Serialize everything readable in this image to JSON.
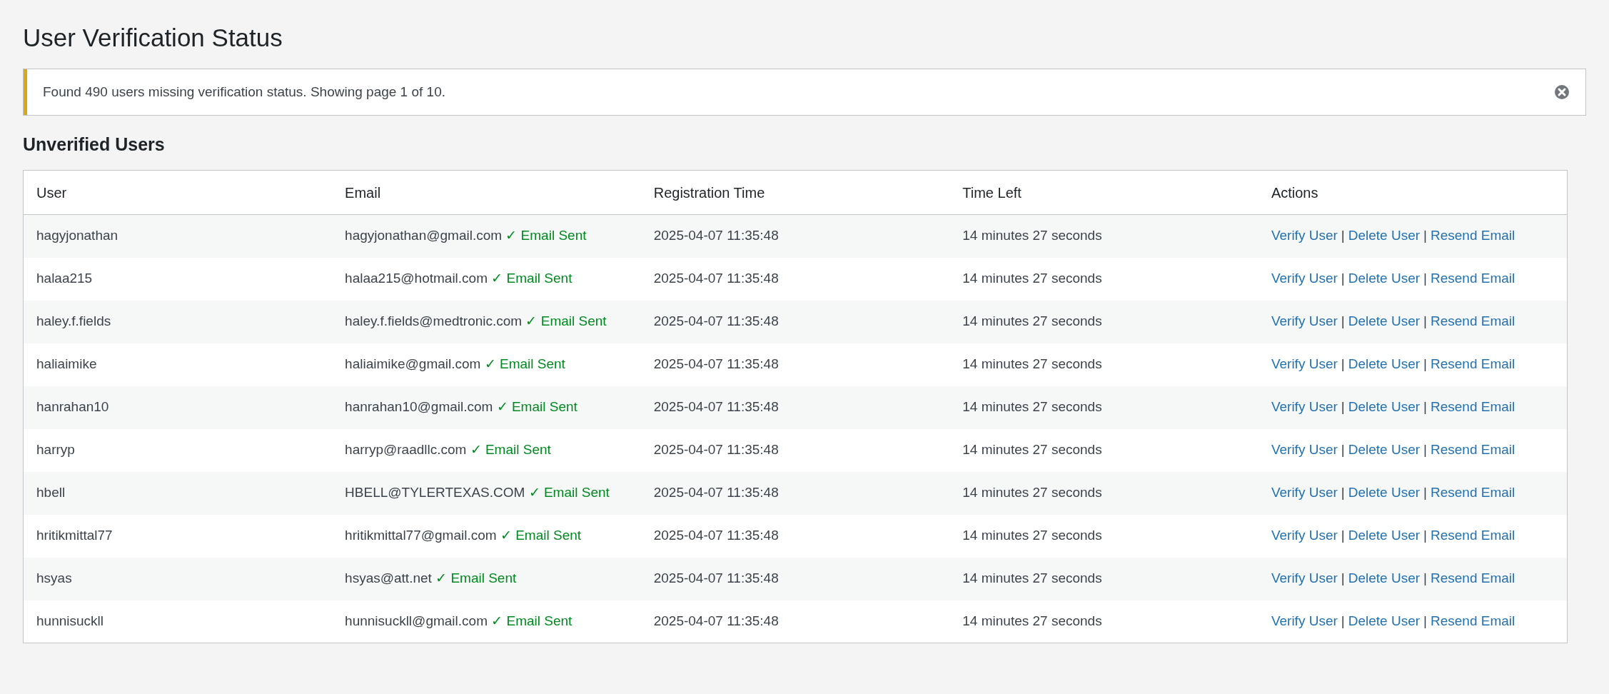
{
  "title": "User Verification Status",
  "notice": {
    "text": "Found 490 users missing verification status. Showing page 1 of 10.",
    "color": "#dba617"
  },
  "section_title": "Unverified Users",
  "table": {
    "columns": [
      "User",
      "Email",
      "Registration Time",
      "Time Left",
      "Actions"
    ],
    "rows": [
      {
        "user": "hagyjonathan",
        "email": "hagyjonathan@gmail.com",
        "status": "✓ Email Sent",
        "registered": "2025-04-07 11:35:48",
        "time_left": "14 minutes 27 seconds",
        "actions": [
          {
            "kind": "link",
            "label": "Verify User"
          },
          {
            "kind": "separator",
            "label": "|"
          },
          {
            "kind": "link",
            "label": "Delete User"
          },
          {
            "kind": "separator",
            "label": "|"
          },
          {
            "kind": "link",
            "label": "Resend Email"
          }
        ]
      },
      {
        "user": "halaa215",
        "email": "halaa215@hotmail.com",
        "status": "✓ Email Sent",
        "registered": "2025-04-07 11:35:48",
        "time_left": "14 minutes 27 seconds",
        "actions": [
          {
            "kind": "link",
            "label": "Verify User"
          },
          {
            "kind": "separator",
            "label": "|"
          },
          {
            "kind": "link",
            "label": "Delete User"
          },
          {
            "kind": "separator",
            "label": "|"
          },
          {
            "kind": "link",
            "label": "Resend Email"
          }
        ]
      },
      {
        "user": "haley.f.fields",
        "email": "haley.f.fields@medtronic.com",
        "status": "✓ Email Sent",
        "registered": "2025-04-07 11:35:48",
        "time_left": "14 minutes 27 seconds",
        "actions": [
          {
            "kind": "link",
            "label": "Verify User"
          },
          {
            "kind": "separator",
            "label": "|"
          },
          {
            "kind": "link",
            "label": "Delete User"
          },
          {
            "kind": "separator",
            "label": "|"
          },
          {
            "kind": "link",
            "label": "Resend Email"
          }
        ]
      },
      {
        "user": "haliaimike",
        "email": "haliaimike@gmail.com",
        "status": "✓ Email Sent",
        "registered": "2025-04-07 11:35:48",
        "time_left": "14 minutes 27 seconds",
        "actions": [
          {
            "kind": "link",
            "label": "Verify User"
          },
          {
            "kind": "separator",
            "label": "|"
          },
          {
            "kind": "link",
            "label": "Delete User"
          },
          {
            "kind": "separator",
            "label": "|"
          },
          {
            "kind": "link",
            "label": "Resend Email"
          }
        ]
      },
      {
        "user": "hanrahan10",
        "email": "hanrahan10@gmail.com",
        "status": "✓ Email Sent",
        "registered": "2025-04-07 11:35:48",
        "time_left": "14 minutes 27 seconds",
        "actions": [
          {
            "kind": "link",
            "label": "Verify User"
          },
          {
            "kind": "separator",
            "label": "|"
          },
          {
            "kind": "link",
            "label": "Delete User"
          },
          {
            "kind": "separator",
            "label": "|"
          },
          {
            "kind": "link",
            "label": "Resend Email"
          }
        ]
      },
      {
        "user": "harryp",
        "email": "harryp@raadllc.com",
        "status": "✓ Email Sent",
        "registered": "2025-04-07 11:35:48",
        "time_left": "14 minutes 27 seconds",
        "actions": [
          {
            "kind": "link",
            "label": "Verify User"
          },
          {
            "kind": "separator",
            "label": "|"
          },
          {
            "kind": "link",
            "label": "Delete User"
          },
          {
            "kind": "separator",
            "label": "|"
          },
          {
            "kind": "link",
            "label": "Resend Email"
          }
        ]
      },
      {
        "user": "hbell",
        "email": "HBELL@TYLERTEXAS.COM",
        "status": "✓ Email Sent",
        "registered": "2025-04-07 11:35:48",
        "time_left": "14 minutes 27 seconds",
        "actions": [
          {
            "kind": "link",
            "label": "Verify User"
          },
          {
            "kind": "separator",
            "label": "|"
          },
          {
            "kind": "link",
            "label": "Delete User"
          },
          {
            "kind": "separator",
            "label": "|"
          },
          {
            "kind": "link",
            "label": "Resend Email"
          }
        ]
      },
      {
        "user": "hritikmittal77",
        "email": "hritikmittal77@gmail.com",
        "status": "✓ Email Sent",
        "registered": "2025-04-07 11:35:48",
        "time_left": "14 minutes 27 seconds",
        "actions": [
          {
            "kind": "link",
            "label": "Verify User"
          },
          {
            "kind": "separator",
            "label": "|"
          },
          {
            "kind": "link",
            "label": "Delete User"
          },
          {
            "kind": "separator",
            "label": "|"
          },
          {
            "kind": "link",
            "label": "Resend Email"
          }
        ]
      },
      {
        "user": "hsyas",
        "email": "hsyas@att.net",
        "status": "✓ Email Sent",
        "registered": "2025-04-07 11:35:48",
        "time_left": "14 minutes 27 seconds",
        "actions": [
          {
            "kind": "link",
            "label": "Verify User"
          },
          {
            "kind": "separator",
            "label": "|"
          },
          {
            "kind": "link",
            "label": "Delete User"
          },
          {
            "kind": "separator",
            "label": "|"
          },
          {
            "kind": "link",
            "label": "Resend Email"
          }
        ]
      },
      {
        "user": "hunnisuckll",
        "email": "hunnisuckll@gmail.com",
        "status": "✓ Email Sent",
        "registered": "2025-04-07 11:35:48",
        "time_left": "14 minutes 27 seconds",
        "actions": [
          {
            "kind": "link",
            "label": "Verify User"
          },
          {
            "kind": "separator",
            "label": "|"
          },
          {
            "kind": "link",
            "label": "Delete User"
          },
          {
            "kind": "separator",
            "label": "|"
          },
          {
            "kind": "link",
            "label": "Resend Email"
          }
        ]
      }
    ]
  }
}
